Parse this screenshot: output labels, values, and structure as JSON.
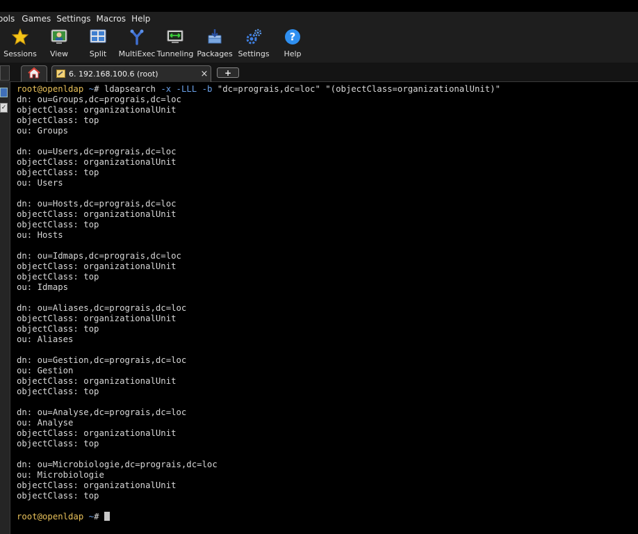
{
  "menu": [
    "ools",
    "Games",
    "Settings",
    "Macros",
    "Help"
  ],
  "toolbar": [
    {
      "label": "Sessions",
      "icon": "star-icon"
    },
    {
      "label": "View",
      "icon": "view-icon"
    },
    {
      "label": "Split",
      "icon": "split-icon"
    },
    {
      "label": "MultiExec",
      "icon": "multiexec-icon"
    },
    {
      "label": "Tunneling",
      "icon": "tunneling-icon"
    },
    {
      "label": "Packages",
      "icon": "packages-icon"
    },
    {
      "label": "Settings",
      "icon": "settings-icon"
    },
    {
      "label": "Help",
      "icon": "help-icon"
    }
  ],
  "tabs": {
    "session_title": "6. 192.168.100.6 (root)",
    "close_glyph": "×",
    "new_tab_glyph": "+"
  },
  "terminal": {
    "prompt_user": "root@openldap",
    "prompt_path": "~",
    "prompt_symbol": "#",
    "command": {
      "cmd": "ldapsearch",
      "opt1": "-x",
      "opt2": "-LLL",
      "opt3": "-b",
      "args": "\"dc=prograis,dc=loc\" \"(objectClass=organizationalUnit)\""
    },
    "output": [
      "dn: ou=Groups,dc=prograis,dc=loc",
      "objectClass: organizationalUnit",
      "objectClass: top",
      "ou: Groups",
      "",
      "dn: ou=Users,dc=prograis,dc=loc",
      "objectClass: organizationalUnit",
      "objectClass: top",
      "ou: Users",
      "",
      "dn: ou=Hosts,dc=prograis,dc=loc",
      "objectClass: organizationalUnit",
      "objectClass: top",
      "ou: Hosts",
      "",
      "dn: ou=Idmaps,dc=prograis,dc=loc",
      "objectClass: organizationalUnit",
      "objectClass: top",
      "ou: Idmaps",
      "",
      "dn: ou=Aliases,dc=prograis,dc=loc",
      "objectClass: organizationalUnit",
      "objectClass: top",
      "ou: Aliases",
      "",
      "dn: ou=Gestion,dc=prograis,dc=loc",
      "ou: Gestion",
      "objectClass: organizationalUnit",
      "objectClass: top",
      "",
      "dn: ou=Analyse,dc=prograis,dc=loc",
      "ou: Analyse",
      "objectClass: organizationalUnit",
      "objectClass: top",
      "",
      "dn: ou=Microbiologie,dc=prograis,dc=loc",
      "ou: Microbiologie",
      "objectClass: organizationalUnit",
      "objectClass: top",
      ""
    ]
  },
  "colors": {
    "prompt_user": "#e8c15a",
    "prompt_path": "#6aa0e8",
    "background": "#000000"
  }
}
